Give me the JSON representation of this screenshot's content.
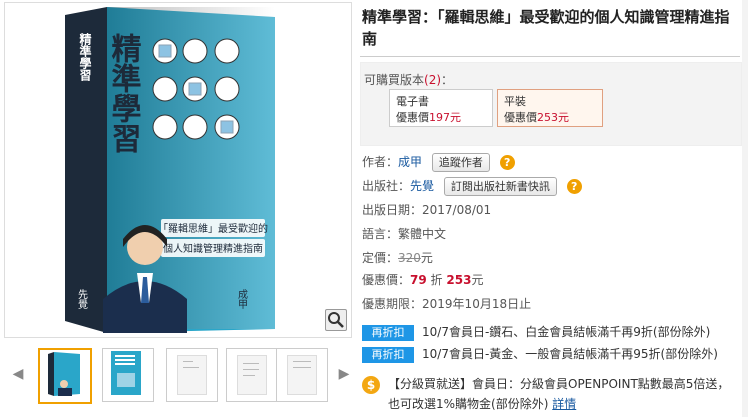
{
  "book": {
    "title": "精準學習：「羅輯思維」最受歡迎的個人知識管理精進指南"
  },
  "cover": {
    "title": "精準學習",
    "publisher_mark": "先覺",
    "tagline_lines": [
      "「羅輯思維」最受歡迎的",
      "個人知識管理精進指南"
    ],
    "author_mark": "成甲"
  },
  "editions": {
    "label_prefix": "可購買版本",
    "count": "(2)",
    "label_suffix": "：",
    "items": [
      {
        "name": "電子書",
        "price_label": "優惠價",
        "price": "197元"
      },
      {
        "name": "平裝",
        "price_label": "優惠價",
        "price": "253元"
      }
    ]
  },
  "info": {
    "author_label": "作者：",
    "author": "成甲",
    "follow_author": "追蹤作者",
    "publisher_label": "出版社：",
    "publisher": "先覺",
    "subscribe": "訂閱出版社新書快訊",
    "pubdate_label": "出版日期：",
    "pubdate": "2017/08/01",
    "language_label": "語言：",
    "language": "繁體中文",
    "list_price_label": "定價：",
    "list_price": "320",
    "list_price_unit": "元",
    "sale_label": "優惠價：",
    "sale_discount": "79",
    "sale_discount_unit": "折",
    "sale_price": "253",
    "sale_price_unit": "元",
    "deadline_label": "優惠期限：",
    "deadline": "2019年10月18日止"
  },
  "promotions": [
    {
      "badge": "再折扣",
      "text": "10/7會員日-鑽石、白金會員結帳滿千再9折(部份除外)"
    },
    {
      "badge": "再折扣",
      "text": "10/7會員日-黃金、一般會員結帳滿千再95折(部份除外)"
    }
  ],
  "bonus": {
    "text": "【分級買就送】會員日：分級會員OPENPOINT點數最高5倍送，也可改選1%購物金(部份除外)",
    "link": "詳情"
  },
  "help_icon": "?",
  "coin_icon": "$",
  "arrows": {
    "left": "◀",
    "right": "▶"
  }
}
